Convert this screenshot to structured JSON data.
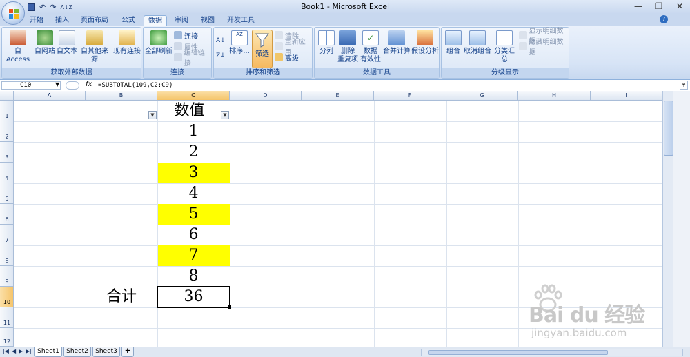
{
  "window": {
    "title": "Book1 - Microsoft Excel"
  },
  "qat": {
    "undo": "↶",
    "redo": "↷",
    "sort": "A↓Z"
  },
  "tabs": [
    "开始",
    "插入",
    "页面布局",
    "公式",
    "数据",
    "审阅",
    "视图",
    "开发工具"
  ],
  "active_tab": "数据",
  "ribbon": {
    "external": {
      "label": "获取外部数据",
      "access": "自 Access",
      "web": "自网站",
      "text": "自文本",
      "other": "自其他来源",
      "existing": "现有连接"
    },
    "connections": {
      "label": "连接",
      "refresh_all": "全部刷新",
      "connections": "连接",
      "properties": "属性",
      "edit_links": "编辑链接"
    },
    "sortfilter": {
      "label": "排序和筛选",
      "sort": "排序...",
      "filter": "筛选",
      "clear": "清除",
      "reapply": "重新应用",
      "advanced": "高级"
    },
    "datatools": {
      "label": "数据工具",
      "split": "分列",
      "remove_dup_1": "删除",
      "remove_dup_2": "重复项",
      "validation_1": "数据",
      "validation_2": "有效性",
      "consolidate": "合并计算",
      "whatif": "假设分析"
    },
    "outline": {
      "label": "分级显示",
      "group": "组合",
      "ungroup": "取消组合",
      "subtotal": "分类汇总",
      "show_detail": "显示明细数据",
      "hide_detail": "隐藏明细数据"
    }
  },
  "formula_bar": {
    "name_box": "C10",
    "fx": "fx",
    "formula": "=SUBTOTAL(109,C2:C9)"
  },
  "columns": [
    "A",
    "B",
    "C",
    "D",
    "E",
    "F",
    "G",
    "H",
    "I"
  ],
  "rows": [
    "1",
    "2",
    "3",
    "4",
    "5",
    "6",
    "7",
    "8",
    "9",
    "10",
    "11",
    "12"
  ],
  "cells": {
    "c1": "数值",
    "c2": "1",
    "c3": "2",
    "c4": "3",
    "c5": "4",
    "c6": "5",
    "c7": "6",
    "c8": "7",
    "c9": "8",
    "b10": "合计",
    "c10": "36"
  },
  "highlight_color": "#ffff00",
  "sheets": [
    "Sheet1",
    "Sheet2",
    "Sheet3"
  ],
  "watermark": {
    "brand": "Bai du 经验",
    "url": "jingyan.baidu.com"
  }
}
